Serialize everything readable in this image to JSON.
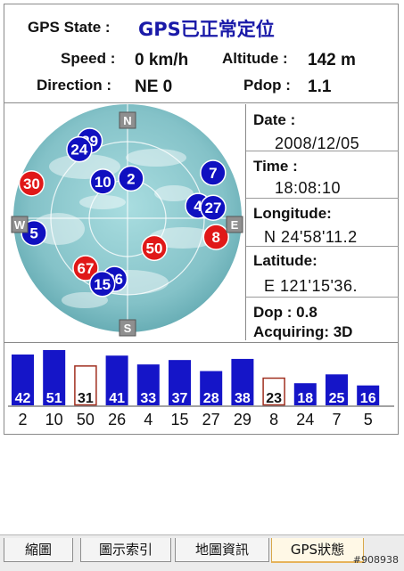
{
  "header": {
    "gps_state_label": "GPS State :",
    "gps_state_value": "GPS已正常定位",
    "speed_label": "Speed :",
    "speed_value": "0 km/h",
    "altitude_label": "Altitude :",
    "altitude_value": "142 m",
    "direction_label": "Direction :",
    "direction_value": "NE 0",
    "pdop_label": "Pdop :",
    "pdop_value": "1.1"
  },
  "compass": {
    "north": "N",
    "south": "S",
    "east": "E",
    "west": "W"
  },
  "sky_satellites": [
    {
      "id": "29",
      "color": "blue",
      "az": -26,
      "r": 0.82
    },
    {
      "id": "24",
      "color": "blue",
      "az": -35,
      "r": 0.8
    },
    {
      "id": "10",
      "color": "blue",
      "az": -34,
      "r": 0.42
    },
    {
      "id": "2",
      "color": "blue",
      "az": 5,
      "r": 0.38
    },
    {
      "id": "7",
      "color": "blue",
      "az": 62,
      "r": 0.92
    },
    {
      "id": "30",
      "color": "red",
      "az": -70,
      "r": 0.97
    },
    {
      "id": "4",
      "color": "blue",
      "az": 80,
      "r": 0.68
    },
    {
      "id": "27",
      "color": "blue",
      "az": 83,
      "r": 0.82
    },
    {
      "id": "8",
      "color": "red",
      "az": 102,
      "r": 0.86
    },
    {
      "id": "5",
      "color": "blue",
      "az": -99,
      "r": 0.9
    },
    {
      "id": "50",
      "color": "red",
      "az": 138,
      "r": 0.38
    },
    {
      "id": "67",
      "color": "red",
      "az": -140,
      "r": 0.62
    },
    {
      "id": "26",
      "color": "blue",
      "az": -168,
      "r": 0.59
    },
    {
      "id": "15",
      "color": "blue",
      "az": -159,
      "r": 0.67
    }
  ],
  "info": {
    "date_label": "Date :",
    "date_value": "2008/12/05",
    "time_label": "Time :",
    "time_value": "18:08:10",
    "longitude_label": "Longitude:",
    "longitude_value": "N  24'58'11.2",
    "latitude_label": "Latitude:",
    "latitude_value": "E 121'15'36.",
    "dop_label": "Dop : 0.8",
    "acquiring_label": "Acquiring: 3D"
  },
  "signal_bars": [
    {
      "snr": "42",
      "prn": "2",
      "level": 0.92,
      "used": true
    },
    {
      "snr": "51",
      "prn": "10",
      "level": 1.0,
      "used": true
    },
    {
      "snr": "31",
      "prn": "50",
      "level": 0.72,
      "used": false
    },
    {
      "snr": "41",
      "prn": "26",
      "level": 0.9,
      "used": true
    },
    {
      "snr": "33",
      "prn": "4",
      "level": 0.74,
      "used": true
    },
    {
      "snr": "37",
      "prn": "15",
      "level": 0.82,
      "used": true
    },
    {
      "snr": "28",
      "prn": "27",
      "level": 0.62,
      "used": true
    },
    {
      "snr": "38",
      "prn": "29",
      "level": 0.84,
      "used": true
    },
    {
      "snr": "23",
      "prn": "8",
      "level": 0.5,
      "used": false
    },
    {
      "snr": "18",
      "prn": "24",
      "level": 0.4,
      "used": true
    },
    {
      "snr": "25",
      "prn": "7",
      "level": 0.56,
      "used": true
    },
    {
      "snr": "16",
      "prn": "5",
      "level": 0.36,
      "used": true
    }
  ],
  "tabs": [
    {
      "label": "縮圖",
      "active": false
    },
    {
      "label": "圖示索引",
      "active": false
    },
    {
      "label": "地圖資訊",
      "active": false
    },
    {
      "label": "GPS狀態",
      "active": true
    }
  ],
  "watermark": "#908938",
  "colors": {
    "used_bar": "#1515c8",
    "unused_bar": "#a03020",
    "sat_blue": "#1010c0",
    "sat_red": "#e01818",
    "gps_state": "#1a1aa8",
    "sky": "#8fc9cc"
  }
}
